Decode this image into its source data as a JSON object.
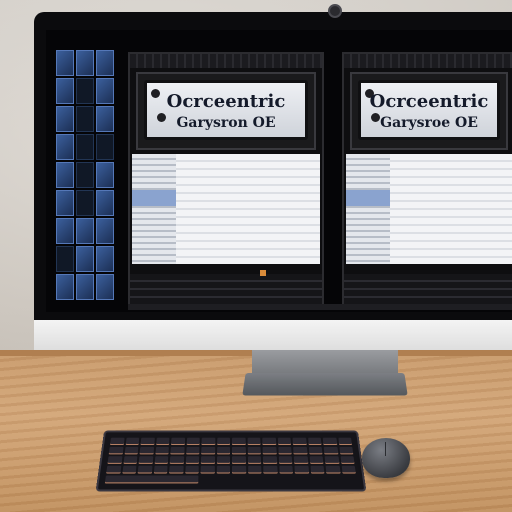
{
  "screen": {
    "panels": [
      {
        "sign_line1": "Ocrceentric",
        "sign_line2": "Garysron OE"
      },
      {
        "sign_line1": "Ocrceentric",
        "sign_line2": "Garysroe OE"
      }
    ]
  },
  "colors": {
    "tile_blue": "#3b5f9c",
    "status_orange": "#d98b3a",
    "desk_wood": "#c89a6b"
  },
  "icons": [
    "camera-icon"
  ]
}
